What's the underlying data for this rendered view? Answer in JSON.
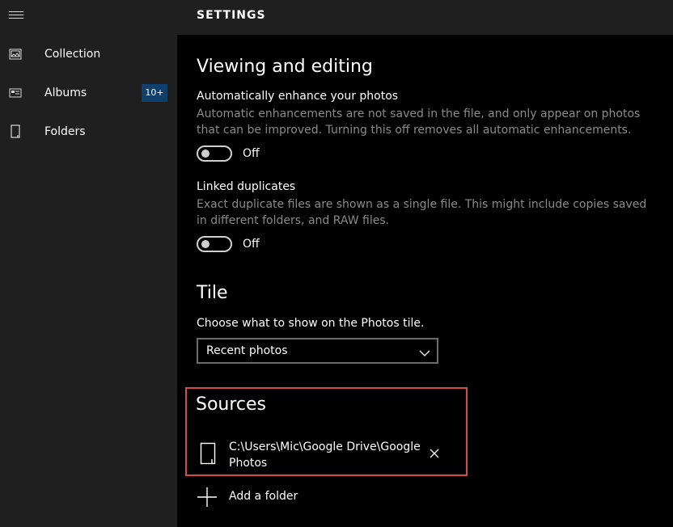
{
  "sidebar": {
    "menu_icon": "hamburger-icon",
    "items": [
      {
        "label": "Collection",
        "icon": "collection-icon"
      },
      {
        "label": "Albums",
        "icon": "albums-icon",
        "badge": "10+"
      },
      {
        "label": "Folders",
        "icon": "folder-icon"
      }
    ]
  },
  "header": {
    "title": "SETTINGS"
  },
  "viewing": {
    "title": "Viewing and editing",
    "enhance": {
      "name": "Automatically enhance your photos",
      "desc": "Automatic enhancements are not saved in the file, and only appear on photos that can be improved. Turning this off removes all automatic enhancements.",
      "state": "Off"
    },
    "duplicates": {
      "name": "Linked duplicates",
      "desc": "Exact duplicate files are shown as a single file. This might include copies saved in different folders, and RAW files.",
      "state": "Off"
    }
  },
  "tile": {
    "title": "Tile",
    "prompt": "Choose what to show on the Photos tile.",
    "selected": "Recent photos"
  },
  "sources": {
    "title": "Sources",
    "folders": [
      {
        "path": "C:\\Users\\Mic\\Google Drive\\Google Photos"
      }
    ],
    "add_label": "Add a folder"
  },
  "colors": {
    "accent_highlight": "#d84a4a",
    "badge_bg": "#0f3f6b",
    "sidebar_bg": "#1f1f1f",
    "desc_text": "#8a8a8a"
  }
}
